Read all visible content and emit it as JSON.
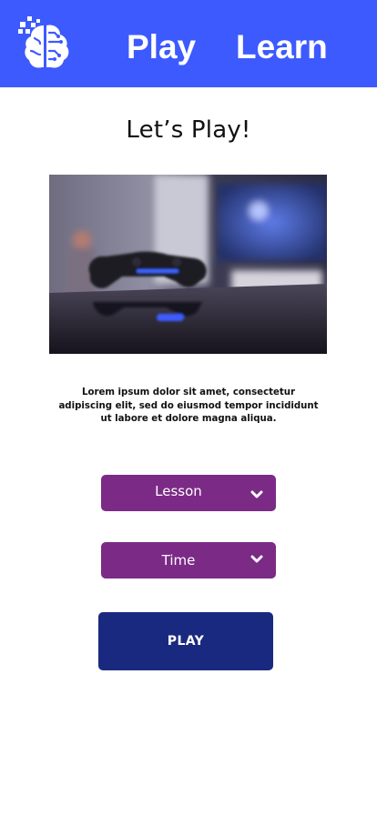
{
  "header": {
    "logo_icon": "brain-circuit-logo-icon",
    "nav": [
      {
        "label": "Play"
      },
      {
        "label": "Learn"
      }
    ],
    "background_color": "#3d5afe"
  },
  "main": {
    "title": "Let’s Play!",
    "hero_image": "game-controller-photo",
    "description": "Lorem ipsum dolor sit amet, consectetur adipiscing elit, sed do eiusmod tempor incididunt ut labore et dolore magna aliqua.",
    "lesson_select": {
      "value": "Lesson",
      "icon": "chevron-down-icon"
    },
    "time_select": {
      "value": "Time",
      "icon": "chevron-down-icon"
    },
    "play_button": {
      "label": "PLAY"
    }
  },
  "colors": {
    "select_bg": "#7b2a86",
    "play_bg": "#1a2980"
  }
}
